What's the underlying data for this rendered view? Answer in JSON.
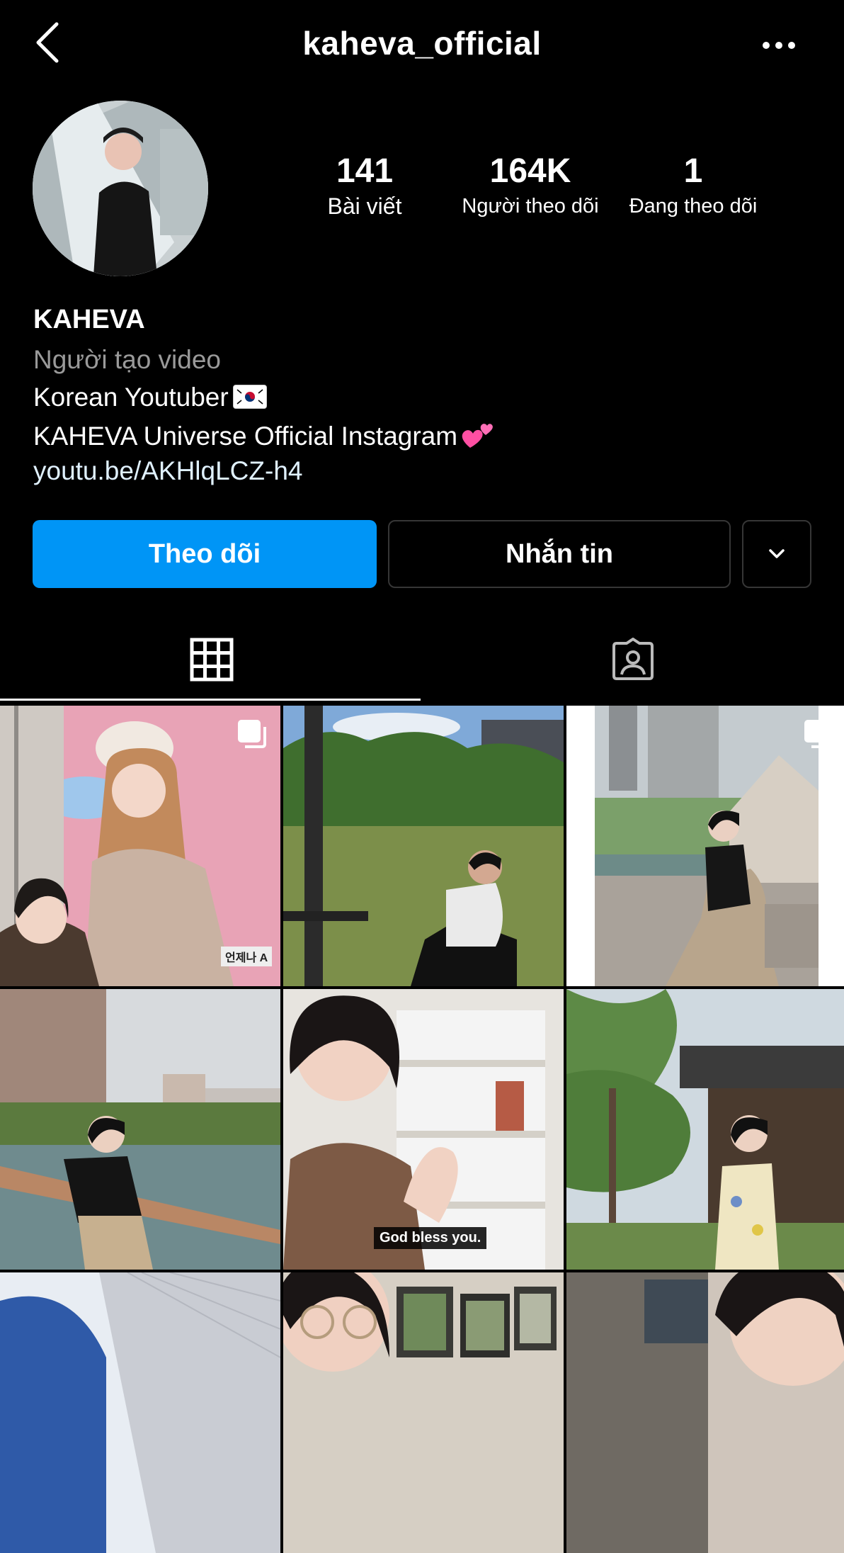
{
  "header": {
    "title": "kaheva_official",
    "back_icon": "chevron-left-icon",
    "more_icon": "more-horizontal-icon"
  },
  "profile": {
    "stats": [
      {
        "value": "141",
        "label": "Bài viết"
      },
      {
        "value": "164K",
        "label": "Người theo dõi"
      },
      {
        "value": "1",
        "label": "Đang theo dõi"
      }
    ],
    "name": "KAHEVA",
    "category": "Người tạo video",
    "bio_line1": "Korean Youtuber",
    "bio_line2": "KAHEVA Universe Official Instagram",
    "link": "youtu.be/AKHlqLCZ-h4"
  },
  "actions": {
    "follow_label": "Theo dõi",
    "message_label": "Nhắn tin",
    "dropdown_icon": "chevron-down-icon"
  },
  "tabs": {
    "active": "grid",
    "items": [
      "grid-icon",
      "tagged-icon"
    ]
  },
  "posts": {
    "grid": [
      {
        "multiple": true,
        "sign": "언제나 A"
      },
      {
        "multiple": false
      },
      {
        "multiple": true
      },
      {
        "multiple": false
      },
      {
        "multiple": false,
        "caption": "God bless you."
      },
      {
        "multiple": false
      },
      {
        "multiple": false
      },
      {
        "multiple": false
      },
      {
        "multiple": false
      }
    ]
  },
  "colors": {
    "background": "#000000",
    "primary": "#0095f6",
    "secondary_text": "#9a9a9a",
    "border": "#363636"
  }
}
